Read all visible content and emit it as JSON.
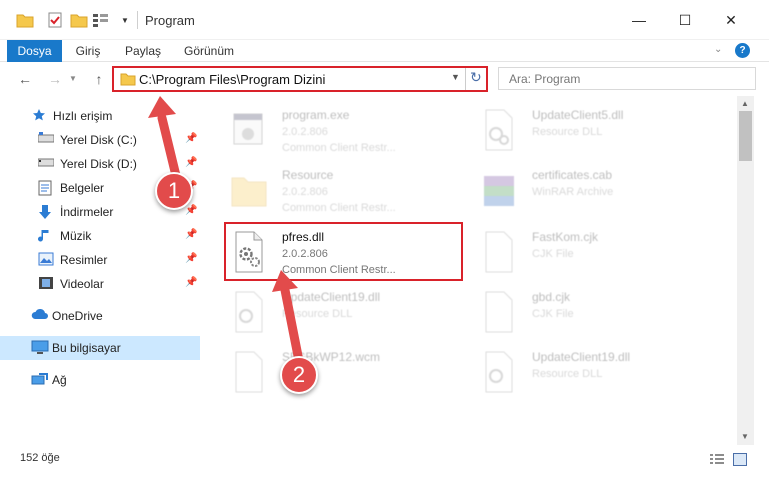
{
  "window": {
    "title": "Program",
    "controls": [
      "minimize",
      "maximize",
      "close"
    ]
  },
  "quick_access_toolbar": [
    "folder-icon",
    "checkmark-icon",
    "new-folder-icon",
    "properties-icon",
    "customize-dropdown"
  ],
  "ribbon": {
    "tabs": [
      {
        "label": "Dosya",
        "active": true
      },
      {
        "label": "Giriş"
      },
      {
        "label": "Paylaş"
      },
      {
        "label": "Görünüm"
      }
    ],
    "accent": "#1979ca"
  },
  "navigation": {
    "address": "C:\\Program Files\\Program Dizini",
    "search_placeholder": "Ara: Program"
  },
  "sidebar": {
    "items": [
      {
        "label": "Hızlı erişim",
        "icon": "star-icon",
        "pinned": false
      },
      {
        "label": "Yerel Disk (C:)",
        "icon": "drive-icon",
        "pinned": true
      },
      {
        "label": "Yerel Disk (D:)",
        "icon": "drive-icon",
        "pinned": true
      },
      {
        "label": "Belgeler",
        "icon": "documents-icon",
        "pinned": true
      },
      {
        "label": "İndirmeler",
        "icon": "download-icon",
        "pinned": true
      },
      {
        "label": "Müzik",
        "icon": "music-icon",
        "pinned": true
      },
      {
        "label": "Resimler",
        "icon": "pictures-icon",
        "pinned": true
      },
      {
        "label": "Videolar",
        "icon": "video-icon",
        "pinned": true
      },
      {
        "label": "OneDrive",
        "icon": "cloud-icon"
      },
      {
        "label": "Bu bilgisayar",
        "icon": "computer-icon",
        "selected": true
      },
      {
        "label": "Ağ",
        "icon": "network-icon"
      }
    ]
  },
  "files": [
    {
      "name": "program.exe",
      "version": "2.0.2.806",
      "desc": "Common Client Restr...",
      "icon": "exe-icon",
      "faded": true
    },
    {
      "name": "UpdateClient5.dll",
      "version": "Resource DLL",
      "desc": "",
      "icon": "dll-icon",
      "faded": true
    },
    {
      "name": "Resource",
      "version": "2.0.2.806",
      "desc": "Common Client Restr...",
      "icon": "folder-icon",
      "faded": true
    },
    {
      "name": "certificates.cab",
      "version": "WinRAR Archive",
      "desc": "",
      "icon": "archive-icon",
      "faded": true
    },
    {
      "name": "pfres.dll",
      "version": "2.0.2.806",
      "desc": "Common Client Restr...",
      "icon": "dll-icon",
      "faded": false
    },
    {
      "name": "FastKom.cjk",
      "version": "CJK File",
      "desc": "",
      "icon": "file-icon",
      "faded": true
    },
    {
      "name": "UpdateClient19.dll",
      "version": "Resource DLL",
      "desc": "",
      "icon": "dll-icon",
      "faded": true
    },
    {
      "name": "gbd.cjk",
      "version": "CJK File",
      "desc": "",
      "icon": "file-icon",
      "faded": true
    },
    {
      "name": "SFSBkWP12.wcm",
      "version": "",
      "desc": "",
      "icon": "file-icon",
      "faded": true
    },
    {
      "name": "UpdateClient19.dll",
      "version": "Resource DLL",
      "desc": "",
      "icon": "dll-icon",
      "faded": true
    }
  ],
  "status": {
    "count": "152 öğe"
  },
  "callouts": [
    "1",
    "2"
  ],
  "highlight_color": "#d9222a"
}
